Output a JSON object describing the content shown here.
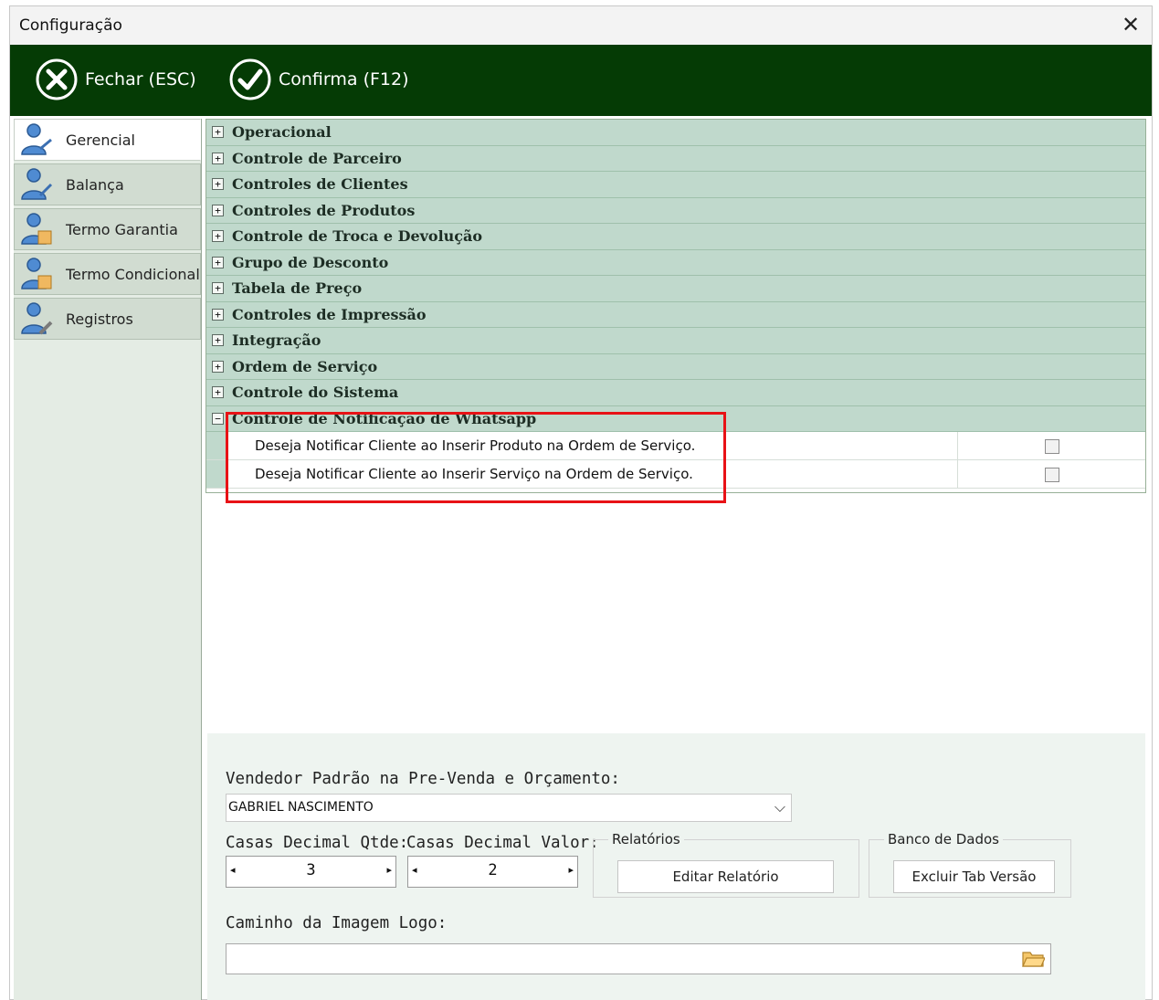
{
  "window": {
    "title": "Configuração",
    "close_glyph": "✕"
  },
  "toolbar": {
    "fechar_label": "Fechar (ESC)",
    "confirma_label": "Confirma (F12)",
    "fechar_icon": "close-circle-icon",
    "confirma_icon": "check-circle-icon",
    "bg_color": "#053b05"
  },
  "sidebar": {
    "items": [
      {
        "label": "Gerencial",
        "active": true
      },
      {
        "label": "Balança",
        "active": false
      },
      {
        "label": "Termo Garantia",
        "active": false
      },
      {
        "label": "Termo Condicional",
        "active": false
      },
      {
        "label": "Registros",
        "active": false
      }
    ]
  },
  "tree": {
    "categories": [
      {
        "label": "Operacional",
        "expanded": false
      },
      {
        "label": "Controle de Parceiro",
        "expanded": false
      },
      {
        "label": "Controles de Clientes",
        "expanded": false
      },
      {
        "label": "Controles de Produtos",
        "expanded": false
      },
      {
        "label": "Controle de Troca e Devolução",
        "expanded": false
      },
      {
        "label": "Grupo de Desconto",
        "expanded": false
      },
      {
        "label": "Tabela de Preço",
        "expanded": false
      },
      {
        "label": "Controles de Impressão",
        "expanded": false
      },
      {
        "label": "Integração",
        "expanded": false
      },
      {
        "label": "Ordem de Serviço",
        "expanded": false
      },
      {
        "label": "Controle do Sistema",
        "expanded": false
      },
      {
        "label": "Controle de Notificação de Whatsapp",
        "expanded": true
      }
    ],
    "whatsapp_options": [
      {
        "label": "Deseja Notificar Cliente ao Inserir Produto na Ordem de Serviço.",
        "checked": false
      },
      {
        "label": "Deseja Notificar Cliente ao Inserir Serviço na Ordem de Serviço.",
        "checked": false
      }
    ],
    "expand_glyph": "+",
    "collapse_glyph": "−",
    "highlight_color": "#e81216"
  },
  "bottom": {
    "vendedor_label": "Vendedor Padrão na Pre-Venda e Orçamento:",
    "vendedor_value": "GABRIEL NASCIMENTO",
    "casas_qtde_label": "Casas Decimal Qtde:",
    "casas_qtde_value": "3",
    "casas_valor_label": "Casas Decimal Valor:",
    "casas_valor_value": "2",
    "relatorios_group": "Relatórios",
    "editar_relatorio_button": "Editar Relatório",
    "banco_group": "Banco de Dados",
    "excluir_tab_button": "Excluir Tab Versão",
    "caminho_label": "Caminho da Imagem Logo:",
    "caminho_value": ""
  }
}
